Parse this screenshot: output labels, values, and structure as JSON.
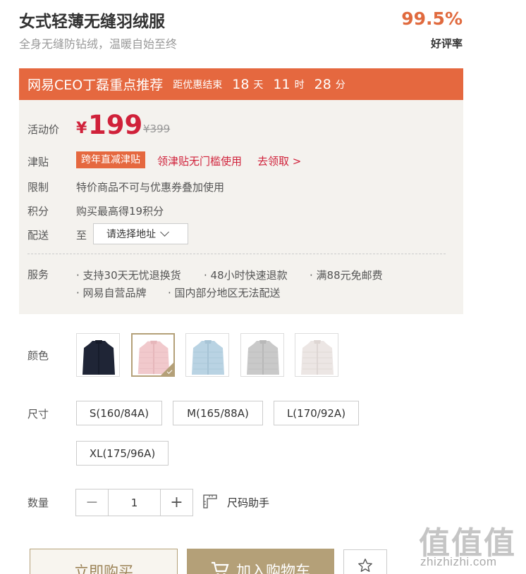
{
  "product": {
    "title": "女式轻薄无缝羽绒服",
    "subtitle": "全身无缝防钻绒，温暖自始至终",
    "rating_value": "99.5%",
    "rating_label": "好评率"
  },
  "promo": {
    "title": "网易CEO丁磊重点推荐",
    "ends_label": "距优惠结束",
    "days": "18",
    "days_unit": "天",
    "hours": "11",
    "hours_unit": "时",
    "minutes": "28",
    "minutes_unit": "分"
  },
  "info": {
    "price_label": "活动价",
    "currency": "¥",
    "price": "199",
    "original_price": "¥399",
    "subsidy_label": "津贴",
    "subsidy_badge": "跨年直减津贴",
    "subsidy_text": "领津贴无门槛使用",
    "subsidy_claim": "去领取 >",
    "limit_label": "限制",
    "limit_text": "特价商品不可与优惠券叠加使用",
    "points_label": "积分",
    "points_text": "购买最高得19积分",
    "delivery_label": "配送",
    "delivery_to": "至",
    "address_placeholder": "请选择地址",
    "service_label": "服务",
    "services": [
      "支持30天无忧退换货",
      "48小时快速退款",
      "满88元免邮费",
      "网易自营品牌",
      "国内部分地区无法配送"
    ]
  },
  "options": {
    "color_label": "颜色",
    "colors": [
      {
        "name": "navy",
        "hex": "#1f2536"
      },
      {
        "name": "pink",
        "hex": "#f1c9cc"
      },
      {
        "name": "light-blue",
        "hex": "#b9d3e3"
      },
      {
        "name": "grey",
        "hex": "#c9c9c9"
      },
      {
        "name": "off-white",
        "hex": "#ece6e4"
      }
    ],
    "selected_color": "pink",
    "size_label": "尺寸",
    "sizes": [
      "S(160/84A)",
      "M(165/88A)",
      "L(170/92A)",
      "XL(175/96A)"
    ],
    "quantity_label": "数量",
    "quantity": "1",
    "size_helper": "尺码助手"
  },
  "actions": {
    "buy_now": "立即购买",
    "add_to_cart": "加入购物车",
    "favorite_icon": "star-icon"
  },
  "watermark": {
    "logo": "值值值",
    "site": "zhizhizhi.com"
  },
  "colors": {
    "accent": "#e5683f",
    "price_red": "#d0213a",
    "gold": "#b4a078"
  }
}
